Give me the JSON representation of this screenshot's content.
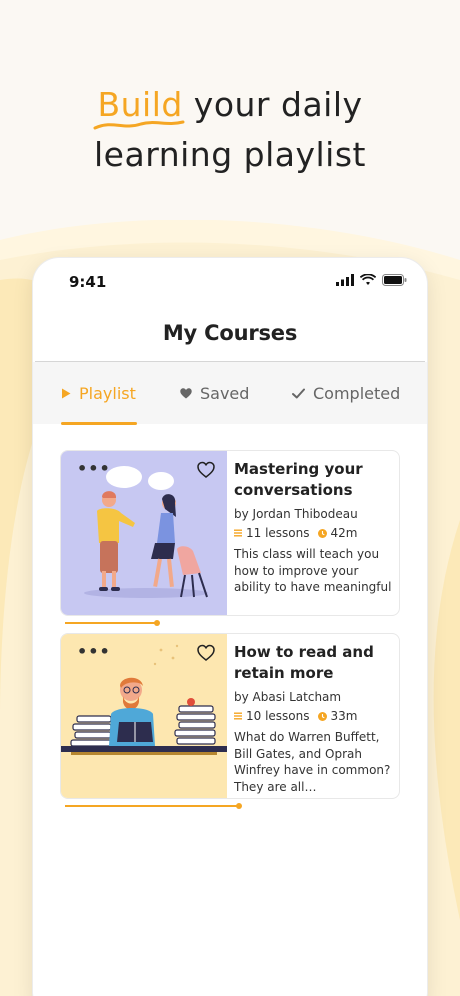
{
  "headline": {
    "accent": "Build",
    "line1_rest": " your daily",
    "line2": "learning playlist"
  },
  "status_bar": {
    "time": "9:41"
  },
  "screen": {
    "title": "My Courses"
  },
  "tabs": [
    {
      "label": "Playlist",
      "icon": "play-icon",
      "active": true
    },
    {
      "label": "Saved",
      "icon": "heart-icon",
      "active": false
    },
    {
      "label": "Completed",
      "icon": "checkmark-icon",
      "active": false
    }
  ],
  "courses": [
    {
      "title": "Mastering your conversations",
      "author": "by Jordan Thibodeau",
      "lessons": "11 lessons",
      "duration": "42m",
      "description": "This class will teach you how to improve your ability to have meaningful",
      "progress": 0.33
    },
    {
      "title": "How to read and retain more",
      "author": "by Abasi Latcham",
      "lessons": "10 lessons",
      "duration": "33m",
      "description": "What do Warren Buffett, Bill Gates, and Oprah Winfrey have in common? They are all…",
      "progress": 0.62
    }
  ],
  "colors": {
    "accent": "#f5a623",
    "card1_bg": "#c7c8f2",
    "card2_bg": "#fde7b0"
  }
}
